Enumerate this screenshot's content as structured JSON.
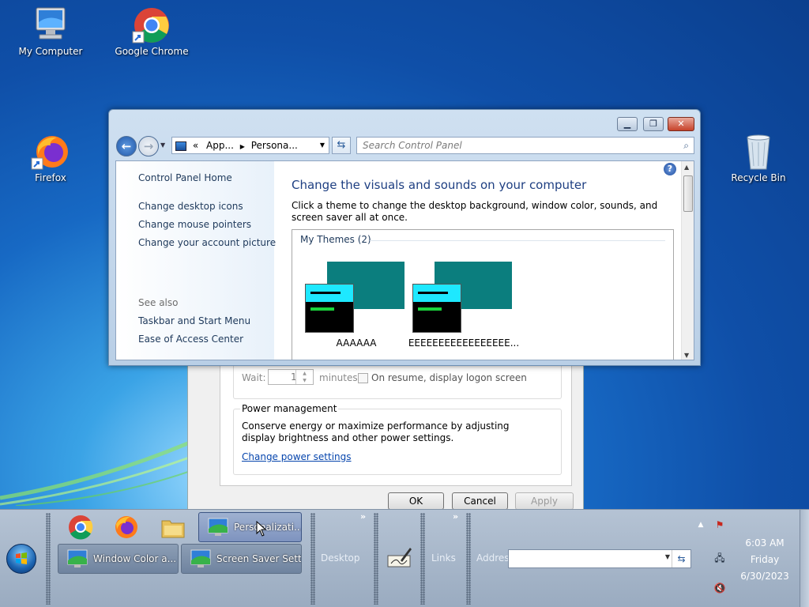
{
  "desktop": {
    "icons": [
      {
        "label": "My Computer",
        "icon": "computer-icon"
      },
      {
        "label": "Google Chrome",
        "icon": "chrome-icon"
      },
      {
        "label": "Firefox",
        "icon": "firefox-icon"
      },
      {
        "label": "Recycle Bin",
        "icon": "recycle-bin-icon"
      }
    ]
  },
  "screensaver_dialog": {
    "wait_label": "Wait:",
    "wait_value": "1",
    "minutes_label": "minutes",
    "resume_label": "On resume, display logon screen",
    "power_group_title": "Power management",
    "power_text": "Conserve energy or maximize performance by adjusting display brightness and other power settings.",
    "power_link": "Change power settings",
    "ok": "OK",
    "cancel": "Cancel",
    "apply": "Apply"
  },
  "window": {
    "breadcrumb": {
      "prefix": "«",
      "part1": "App...",
      "part2": "Persona..."
    },
    "search_placeholder": "Search Control Panel",
    "sidebar": {
      "home": "Control Panel Home",
      "links": [
        "Change desktop icons",
        "Change mouse pointers",
        "Change your account picture"
      ],
      "see_also": "See also",
      "see_also_links": [
        "Taskbar and Start Menu",
        "Ease of Access Center"
      ]
    },
    "main": {
      "heading": "Change the visuals and sounds on your computer",
      "description": "Click a theme to change the desktop background, window color, sounds, and screen saver all at once.",
      "themes_group": "My Themes (2)",
      "themes": [
        {
          "name": "AAAAAA"
        },
        {
          "name": "EEEEEEEEEEEEEEEEE..."
        }
      ]
    }
  },
  "taskbar": {
    "buttons": [
      {
        "label": "Personalizati...",
        "active": true
      },
      {
        "label": "Window Color a...",
        "active": false
      },
      {
        "label": "Screen Saver Sett...",
        "active": false
      }
    ],
    "desktop_label": "Desktop",
    "links_label": "Links",
    "address_label": "Address",
    "address_value": "",
    "clock": {
      "time": "6:03 AM",
      "day": "Friday",
      "date": "6/30/2023"
    }
  },
  "colors": {
    "accent_link": "#1e395b",
    "heading": "#1e3f82",
    "theme_teal": "#0b7e7e",
    "theme_cyan": "#1ee8ff",
    "theme_green": "#19d53c"
  }
}
